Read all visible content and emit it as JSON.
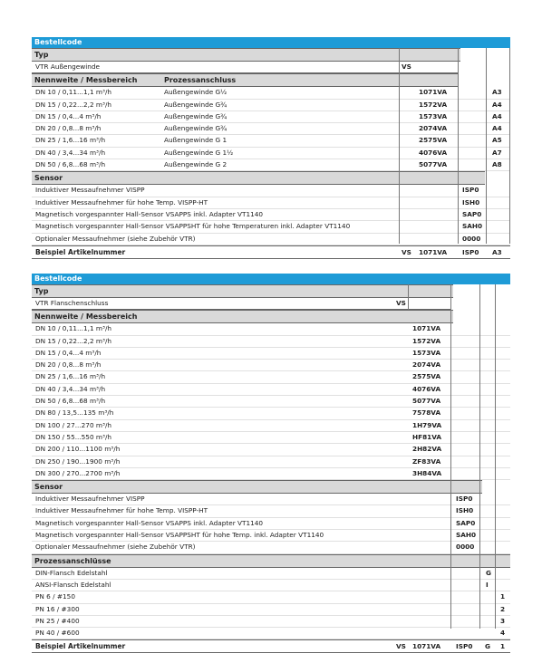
{
  "table1": {
    "header": "Bestellcode",
    "typ_label": "Typ",
    "typ_row": {
      "label": "VTR Außengewinde",
      "code": "VS"
    },
    "nenn_label": "Nennweite / Messbereich",
    "prozess_label": "Prozessanschluss",
    "rows": [
      {
        "range": "DN 10 / 0,11...1,1 m³/h",
        "conn": "Außengewinde G½",
        "code": "1071VA",
        "ext": "A3"
      },
      {
        "range": "DN 15 / 0,22...2,2 m³/h",
        "conn": "Außengewinde G¾",
        "code": "1572VA",
        "ext": "A4"
      },
      {
        "range": "DN 15 / 0,4...4 m³/h",
        "conn": "Außengewinde G¾",
        "code": "1573VA",
        "ext": "A4"
      },
      {
        "range": "DN 20 / 0,8...8 m³/h",
        "conn": "Außengewinde G¾",
        "code": "2074VA",
        "ext": "A4"
      },
      {
        "range": "DN 25 / 1,6...16 m³/h",
        "conn": "Außengewinde G 1",
        "code": "2575VA",
        "ext": "A5"
      },
      {
        "range": "DN 40 / 3,4...34 m³/h",
        "conn": "Außengewinde G 1½",
        "code": "4076VA",
        "ext": "A7"
      },
      {
        "range": "DN 50 / 6,8...68 m³/h",
        "conn": "Außengewinde G 2",
        "code": "5077VA",
        "ext": "A8"
      }
    ],
    "sensor_label": "Sensor",
    "sensors": [
      {
        "label": "Induktiver Messaufnehmer VISPP",
        "code": "ISP0"
      },
      {
        "label": "Induktiver Messaufnehmer für hohe Temp. VISPP-HT",
        "code": "ISH0"
      },
      {
        "label": "Magnetisch vorgespannter Hall-Sensor VSAPPS inkl. Adapter VT1140",
        "code": "SAP0"
      },
      {
        "label": "Magnetisch vorgespannter Hall-Sensor VSAPPSHT für hohe Temperaturen inkl. Adapter VT1140",
        "code": "SAH0"
      },
      {
        "label": "Optionaler Messaufnehmer (siehe Zubehör VTR)",
        "code": "0000"
      }
    ],
    "example": {
      "label": "Beispiel Artikelnummer",
      "c1": "VS",
      "c2": "1071VA",
      "c3": "ISP0",
      "c4": "A3"
    }
  },
  "table2": {
    "header": "Bestellcode",
    "typ_label": "Typ",
    "typ_row": {
      "label": "VTR Flanschenschluss",
      "code": "VS"
    },
    "nenn_label": "Nennweite / Messbereich",
    "rows": [
      {
        "range": "DN 10 / 0,11...1,1 m³/h",
        "code": "1071VA"
      },
      {
        "range": "DN 15 / 0,22...2,2 m³/h",
        "code": "1572VA"
      },
      {
        "range": "DN 15 / 0,4...4 m³/h",
        "code": "1573VA"
      },
      {
        "range": "DN 20 / 0,8...8 m³/h",
        "code": "2074VA"
      },
      {
        "range": "DN 25 / 1,6...16 m³/h",
        "code": "2575VA"
      },
      {
        "range": "DN 40 / 3,4...34 m³/h",
        "code": "4076VA"
      },
      {
        "range": "DN 50 / 6,8...68 m³/h",
        "code": "5077VA"
      },
      {
        "range": "DN 80 / 13,5...135 m³/h",
        "code": "7578VA"
      },
      {
        "range": "DN 100 / 27...270 m³/h",
        "code": "1H79VA"
      },
      {
        "range": "DN 150 / 55...550 m³/h",
        "code": "HF81VA"
      },
      {
        "range": "DN 200 / 110...1100 m³/h",
        "code": "2H82VA"
      },
      {
        "range": "DN 250 / 190...1900 m³/h",
        "code": "ZF83VA"
      },
      {
        "range": "DN 300 / 270...2700 m³/h",
        "code": "3H84VA"
      }
    ],
    "sensor_label": "Sensor",
    "sensors": [
      {
        "label": "Induktiver Messaufnehmer VISPP",
        "code": "ISP0"
      },
      {
        "label": "Induktiver Messaufnehmer für hohe Temp. VISPP-HT",
        "code": "ISH0"
      },
      {
        "label": "Magnetisch vorgespannter Hall-Sensor VSAPPS inkl. Adapter VT1140",
        "code": "SAP0"
      },
      {
        "label": "Magnetisch vorgespannter Hall-Sensor VSAPPSHT für hohe Temp. inkl. Adapter VT1140",
        "code": "SAH0"
      },
      {
        "label": "Optionaler Messaufnehmer (siehe Zubehör VTR)",
        "code": "0000"
      }
    ],
    "prozess_label": "Prozessanschlüsse",
    "flanges": [
      {
        "label": "DIN-Flansch Edelstahl",
        "code": "G"
      },
      {
        "label": "ANSI-Flansch Edelstahl",
        "code": "I"
      }
    ],
    "pressures": [
      {
        "label": "PN 6 / #150",
        "code": "1"
      },
      {
        "label": "PN 16 / #300",
        "code": "2"
      },
      {
        "label": "PN 25 / #400",
        "code": "3"
      },
      {
        "label": "PN 40 / #600",
        "code": "4"
      }
    ],
    "example": {
      "label": "Beispiel Artikelnummer",
      "c1": "VS",
      "c2": "1071VA",
      "c3": "ISP0",
      "c4": "G",
      "c5": "1"
    }
  }
}
